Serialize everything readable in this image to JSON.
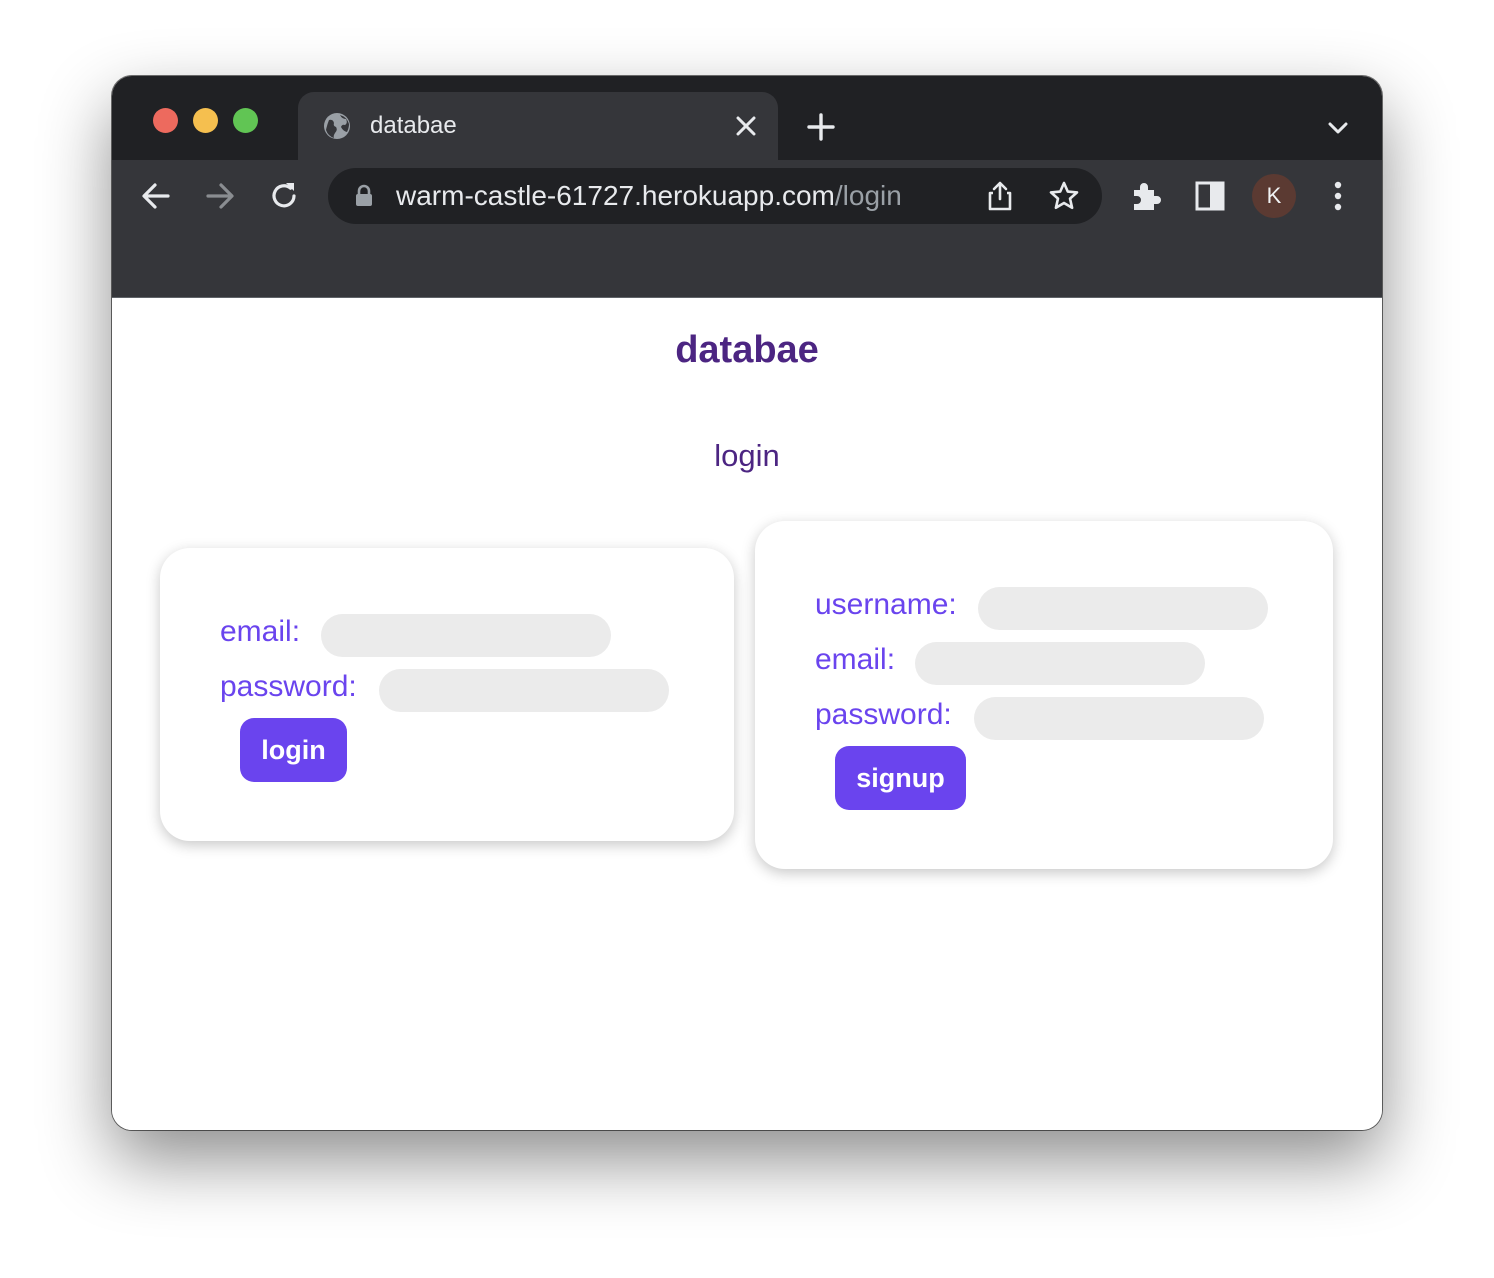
{
  "browser": {
    "tab": {
      "title": "databae"
    },
    "address_bar": {
      "host": "warm-castle-61727.herokuapp.com",
      "path": "/login"
    },
    "profile_initial": "K",
    "icons": {
      "tab_favicon": "globe-icon",
      "tab_close": "close-icon",
      "new_tab": "plus-icon",
      "tab_search": "chevron-down-icon",
      "back": "arrow-left-icon",
      "forward": "arrow-right-icon",
      "reload": "reload-icon",
      "lock": "lock-icon",
      "share": "share-icon",
      "bookmark": "star-icon",
      "extensions": "puzzle-icon",
      "side_panel": "side-panel-icon",
      "menu": "kebab-menu-icon"
    }
  },
  "page": {
    "site_title": "databae",
    "heading": "login",
    "login_form": {
      "email_label": "email:",
      "password_label": "password:",
      "submit_label": "login"
    },
    "signup_form": {
      "username_label": "username:",
      "email_label": "email:",
      "password_label": "password:",
      "submit_label": "signup"
    }
  },
  "colors": {
    "brand_dark": "#4c2582",
    "brand_accent": "#6a44ee",
    "input_bg": "#ebebeb"
  }
}
